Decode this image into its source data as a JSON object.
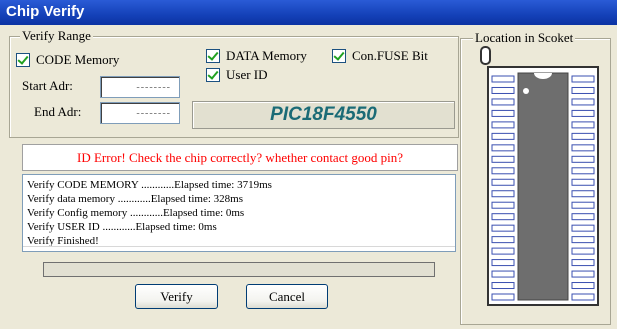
{
  "window": {
    "title": "Chip Verify"
  },
  "verify_range": {
    "legend": "Verify Range",
    "code_memory": {
      "label": "CODE Memory",
      "checked": true
    },
    "data_memory": {
      "label": "DATA Memory",
      "checked": true
    },
    "con_fuse": {
      "label": "Con.FUSE Bit",
      "checked": true
    },
    "user_id": {
      "label": "User ID",
      "checked": true
    },
    "start_adr": {
      "label": "Start Adr:",
      "value": "--------"
    },
    "end_adr": {
      "label": "End Adr:",
      "value": "--------"
    },
    "chip_name": "PIC18F4550"
  },
  "error_message": "ID Error! Check the chip correctly? whether contact good pin?",
  "log": [
    "Verify CODE MEMORY ............Elapsed time: 3719ms",
    "Verify data memory ............Elapsed time: 328ms",
    "Verify Config memory ............Elapsed time: 0ms",
    "Verify USER ID ............Elapsed time: 0ms",
    "Verify Finished!"
  ],
  "progress": {
    "fraction": 0
  },
  "buttons": {
    "verify": "Verify",
    "cancel": "Cancel"
  },
  "socket": {
    "legend": "Location in Scoket",
    "pins_per_side": 20
  }
}
